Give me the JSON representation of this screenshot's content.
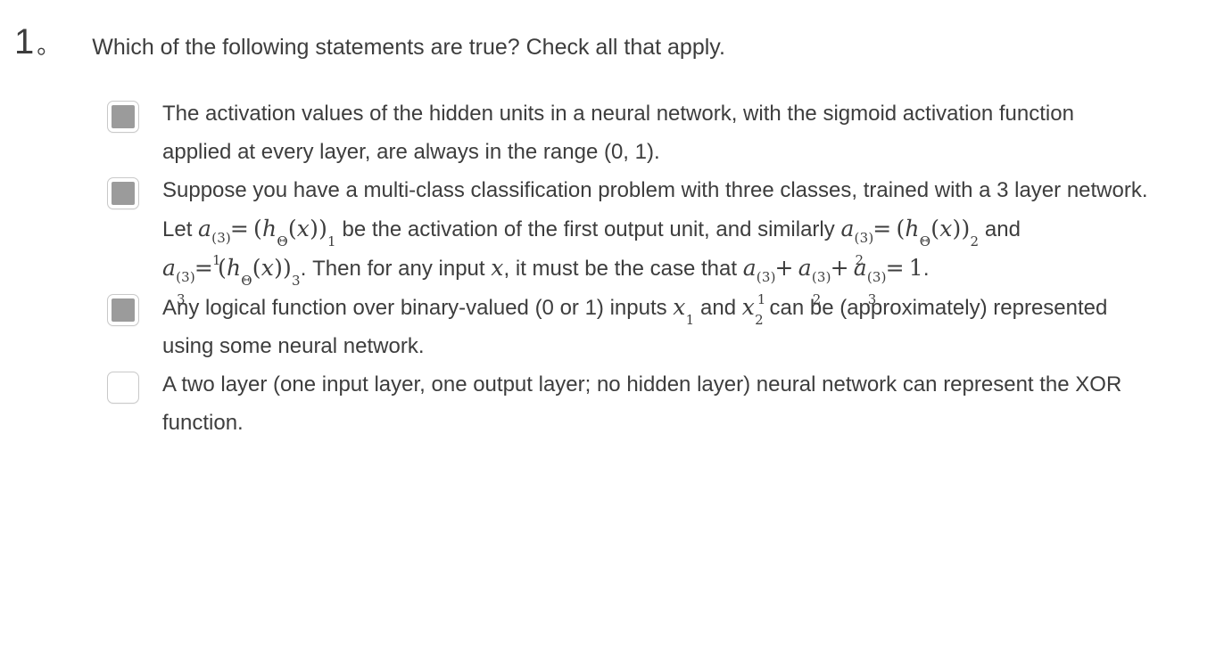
{
  "question": {
    "number": "1",
    "number_dot": "。",
    "prompt": "Which of the following statements are true? Check all that apply.",
    "text_color": "#3d3d3d",
    "checked_fill_color": "#9b9b9b",
    "checkbox_border_color": "#c9c9c9"
  },
  "options": [
    {
      "id": "option-1",
      "checked": true,
      "checkbox_state": "checked",
      "text": "The activation values of the hidden units in a neural network, with the sigmoid activation function applied at every layer, are always in the range (0, 1)."
    },
    {
      "id": "option-2",
      "checked": true,
      "checkbox_state": "checked",
      "text": "Suppose you have a multi-class classification problem with three classes, trained with a 3 layer network. Let a_1^(3) = (h_Θ(x))_1 be the activation of the first output unit, and similarly a_2^(3) = (h_Θ(x))_2 and a_3^(3) = (h_Θ(x))_3. Then for any input x, it must be the case that a_1^(3) + a_2^(3) + a_3^(3) = 1.",
      "segments": {
        "s1": "Suppose you have a multi-class classification problem with three classes, trained with a 3 layer network. Let ",
        "s2": " be the activation of the first output unit, and similarly ",
        "s3": " and ",
        "s4": ". Then for any input ",
        "s5": ", it must be the case that ",
        "s6": "."
      },
      "math": {
        "a_letter": "a",
        "sup": "(3)",
        "sub1": "1",
        "sub2": "2",
        "sub3": "3",
        "equals": "=",
        "plus": "+",
        "h": "h",
        "theta": "Θ",
        "x": "x",
        "one": "1",
        "open": "(",
        "close": ")"
      }
    },
    {
      "id": "option-3",
      "checked": true,
      "checkbox_state": "checked",
      "text": "Any logical function over binary-valued (0 or 1) inputs x_1 and x_2 can be (approximately) represented using some neural network.",
      "segments": {
        "s1": "Any logical function over binary-valued (0 or 1) inputs ",
        "s2": " and ",
        "s3": " can be (approximately) represented using some neural network."
      },
      "math": {
        "x": "x",
        "sub1": "1",
        "sub2": "2"
      }
    },
    {
      "id": "option-4",
      "checked": false,
      "checkbox_state": "unchecked",
      "text": "A two layer (one input layer, one output layer; no hidden layer) neural network can represent the XOR function."
    }
  ]
}
